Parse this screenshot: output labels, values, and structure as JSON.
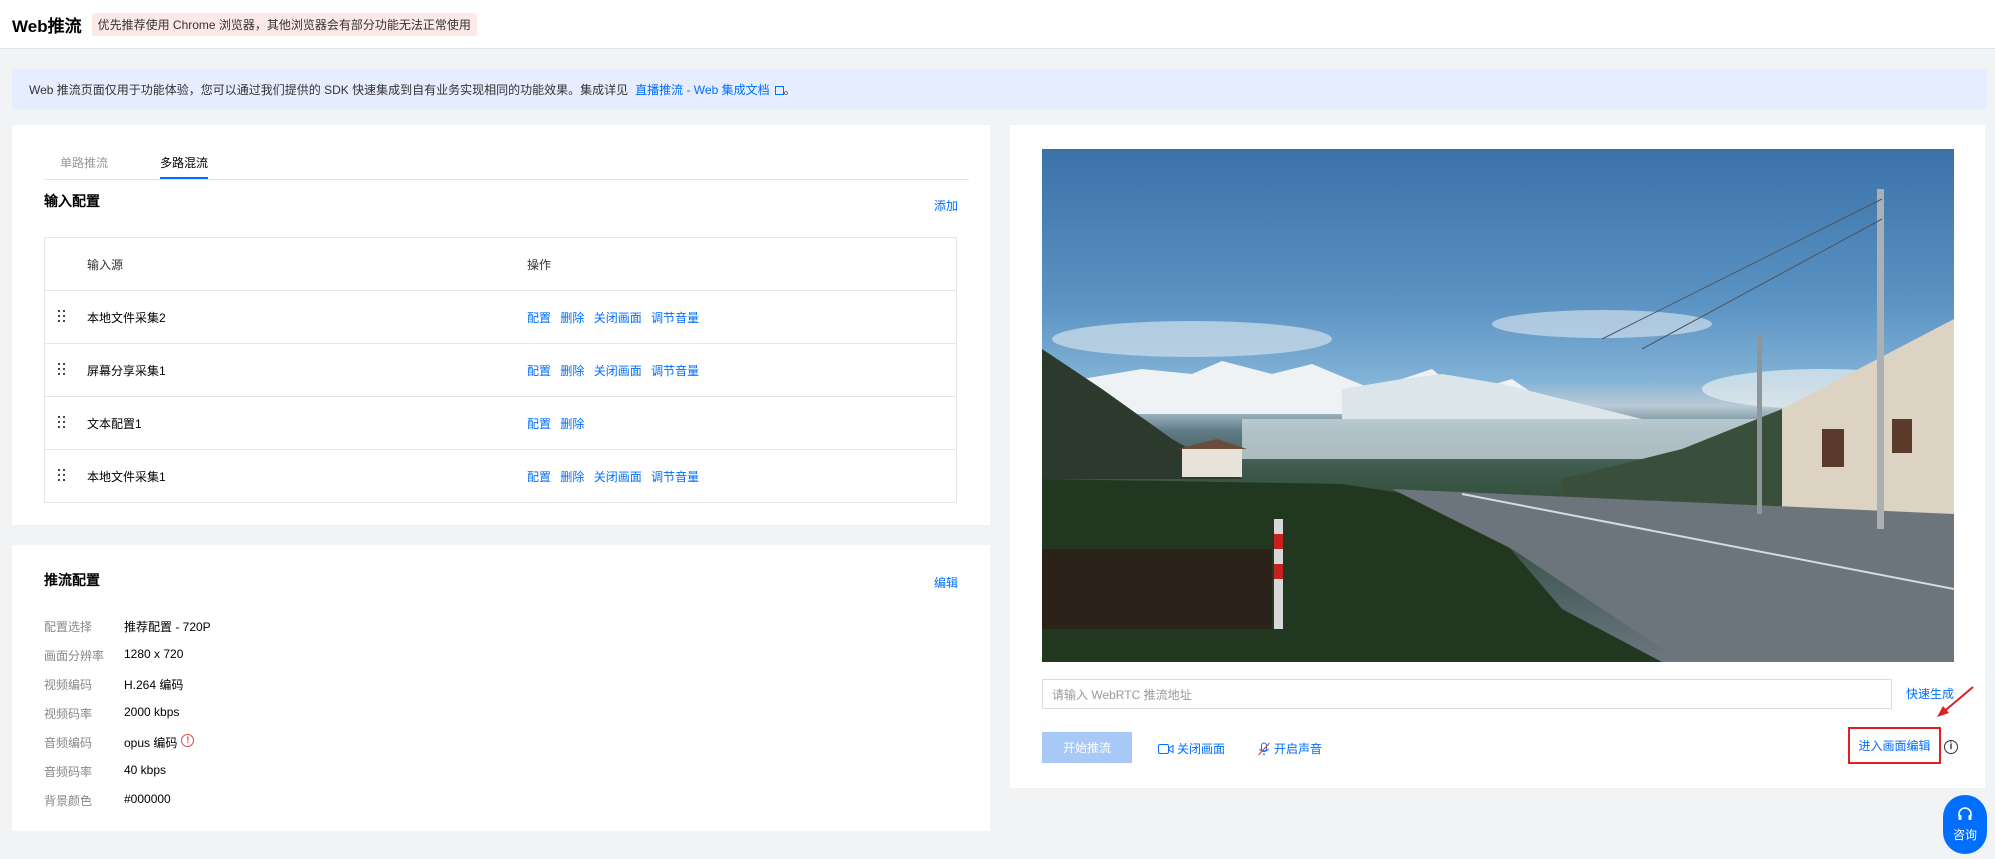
{
  "header": {
    "title": "Web推流",
    "browser_tip": "优先推荐使用 Chrome 浏览器，其他浏览器会有部分功能无法正常使用"
  },
  "notice": {
    "text": "Web 推流页面仅用于功能体验，您可以通过我们提供的 SDK 快速集成到自有业务实现相同的功能效果。集成详见",
    "link": "直播推流 - Web 集成文档",
    "suffix": "。"
  },
  "tabs": [
    {
      "label": "单路推流",
      "active": false
    },
    {
      "label": "多路混流",
      "active": true
    }
  ],
  "input_config": {
    "title": "输入配置",
    "add_label": "添加",
    "columns": [
      "输入源",
      "操作"
    ],
    "rows": [
      {
        "name": "本地文件采集2",
        "actions": [
          "配置",
          "删除",
          "关闭画面",
          "调节音量"
        ]
      },
      {
        "name": "屏幕分享采集1",
        "actions": [
          "配置",
          "删除",
          "关闭画面",
          "调节音量"
        ]
      },
      {
        "name": "文本配置1",
        "actions": [
          "配置",
          "删除"
        ]
      },
      {
        "name": "本地文件采集1",
        "actions": [
          "配置",
          "删除",
          "关闭画面",
          "调节音量"
        ]
      }
    ]
  },
  "push_config": {
    "title": "推流配置",
    "edit_label": "编辑",
    "items": [
      {
        "key": "配置选择",
        "value": "推荐配置 - 720P"
      },
      {
        "key": "画面分辨率",
        "value": "1280 x 720"
      },
      {
        "key": "视频编码",
        "value": "H.264 编码"
      },
      {
        "key": "视频码率",
        "value": "2000 kbps"
      },
      {
        "key": "音频编码",
        "value": "opus 编码"
      },
      {
        "key": "音频码率",
        "value": "40 kbps"
      },
      {
        "key": "背景颜色",
        "value": "#000000"
      }
    ]
  },
  "preview": {
    "url_placeholder": "请输入 WebRTC 推流地址",
    "quick_generate": "快速生成",
    "start_button": "开始推流",
    "close_video": "关闭画面",
    "open_audio": "开启声音",
    "enter_edit": "进入画面编辑"
  },
  "consult": {
    "label": "咨询"
  },
  "colors": {
    "accent": "#006eff",
    "highlight": "#e02020",
    "disabled_button": "#a8c8f5"
  }
}
